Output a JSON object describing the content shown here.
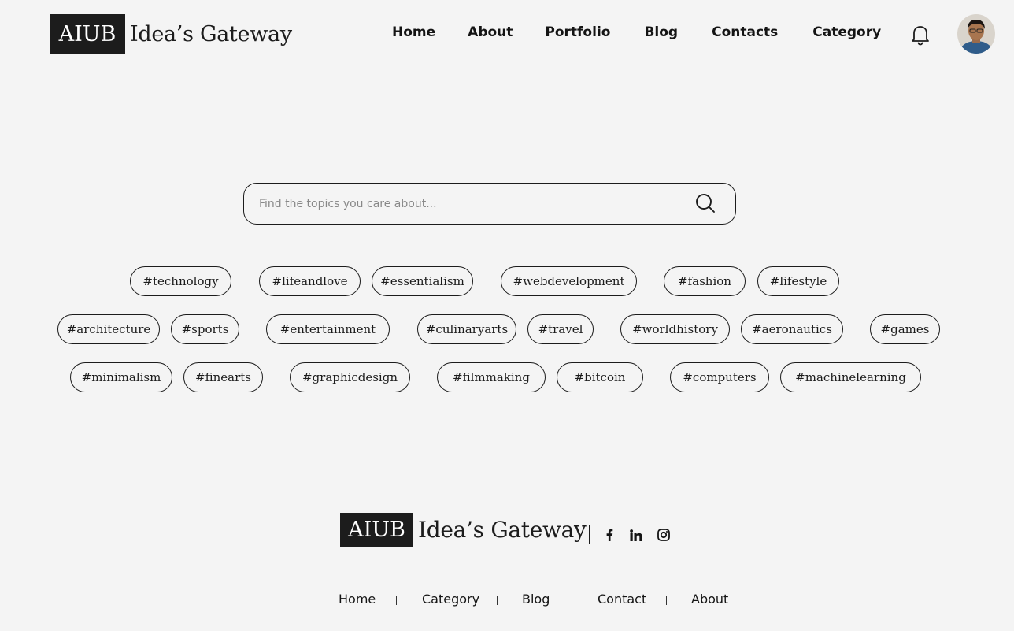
{
  "brand": {
    "box_text": "AIUB",
    "name": "Idea’s Gateway"
  },
  "nav": {
    "items": [
      "Home",
      "About",
      "Portfolio",
      "Blog",
      "Contacts",
      "Category"
    ]
  },
  "icons": {
    "notifications": "bell-icon",
    "avatar": "user-avatar",
    "search": "search-icon",
    "facebook": "facebook-icon",
    "linkedin": "linkedin-icon",
    "instagram": "instagram-icon"
  },
  "search": {
    "placeholder": "Find the topics you care about...",
    "value": ""
  },
  "tags": {
    "row1": [
      "#technology",
      "#lifeandlove",
      "#essentialism",
      "#webdevelopment",
      "#fashion",
      "#lifestyle"
    ],
    "row2": [
      "#architecture",
      "#sports",
      "#entertainment",
      "#culinaryarts",
      "#travel",
      "#worldhistory",
      "#aeronautics",
      "#games"
    ],
    "row3": [
      "#minimalism",
      "#finearts",
      "#graphicdesign",
      "#filmmaking",
      "#bitcoin",
      "#computers",
      "#machinelearning"
    ]
  },
  "footer": {
    "nav": [
      "Home",
      "Category",
      "Blog",
      "Contact",
      "About"
    ]
  },
  "colors": {
    "background": "#f4f4f4",
    "ink": "#1c1c1c"
  }
}
